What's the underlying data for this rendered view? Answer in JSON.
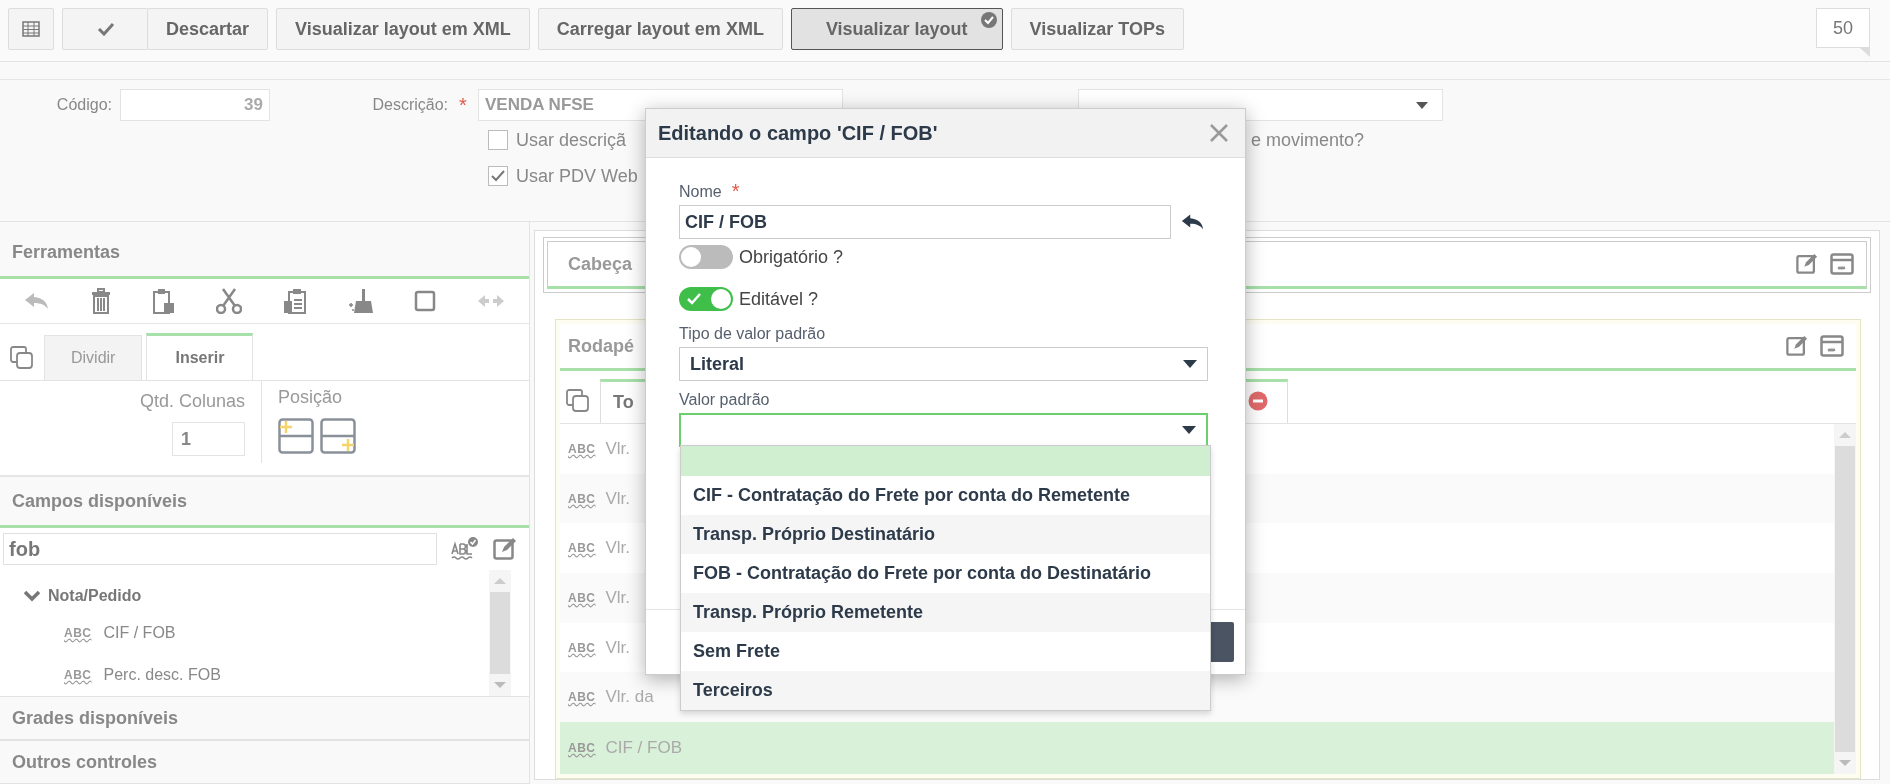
{
  "toolbar": {
    "buttons": [
      {
        "label": "Descartar",
        "selected": false
      },
      {
        "label": "Visualizar layout em XML",
        "selected": false
      },
      {
        "label": "Carregar layout em XML",
        "selected": false
      },
      {
        "label": "Visualizar layout",
        "selected": true
      },
      {
        "label": "Visualizar TOPs",
        "selected": false
      }
    ],
    "counter": "50"
  },
  "form": {
    "code_label": "Código:",
    "code_value": "39",
    "desc_label": "Descrição:",
    "desc_required_mark": "*",
    "desc_value": "VENDA NFSE",
    "checkboxes": [
      {
        "label": "Usar descriçã",
        "checked": false
      },
      {
        "label": "Usar PDV Web",
        "checked": true
      }
    ],
    "right_note": "e movimento?"
  },
  "left_panel": {
    "tools_title": "Ferramentas",
    "tabs": [
      {
        "label": "Dividir",
        "selected": false
      },
      {
        "label": "Inserir",
        "selected": true
      }
    ],
    "columns_label": "Qtd. Colunas",
    "columns_value": "1",
    "position_label": "Posição",
    "fields_title": "Campos disponíveis",
    "search_value": "fob",
    "tree": [
      {
        "label": "Nota/Pedido",
        "expanded": true,
        "children": [
          {
            "badge": "ABC",
            "label": "CIF / FOB"
          },
          {
            "badge": "ABC",
            "label": "Perc. desc. FOB"
          }
        ]
      }
    ],
    "sections": [
      "Grades disponíveis",
      "Outros controles"
    ]
  },
  "layout_panel": {
    "header_title": "Cabeça",
    "footer_title": "Rodapé",
    "tab_label": "To",
    "rows": [
      {
        "badge": "ABC",
        "label": "Vlr.",
        "selected": false
      },
      {
        "badge": "ABC",
        "label": "Vlr.",
        "selected": false
      },
      {
        "badge": "ABC",
        "label": "Vlr.",
        "selected": false
      },
      {
        "badge": "ABC",
        "label": "Vlr.",
        "selected": false
      },
      {
        "badge": "ABC",
        "label": "Vlr.",
        "selected": false
      },
      {
        "badge": "ABC",
        "label": "Vlr. da",
        "selected": false
      },
      {
        "badge": "ABC",
        "label": "CIF / FOB",
        "selected": true
      }
    ]
  },
  "dialog": {
    "title": "Editando o campo 'CIF / FOB'",
    "name_label": "Nome",
    "name_required_mark": "*",
    "name_value": "CIF / FOB",
    "toggles": [
      {
        "label": "Obrigatório ?",
        "on": false
      },
      {
        "label": "Editável ?",
        "on": true
      }
    ],
    "type_label": "Tipo de valor padrão",
    "type_value": "Literal",
    "default_label": "Valor padrão",
    "blank_option_selected": true,
    "options": [
      {
        "label": "CIF - Contratação do Frete por conta do Remetente"
      },
      {
        "label": "Transp. Próprio Destinatário"
      },
      {
        "label": "FOB - Contratação do Frete por conta do Destinatário"
      },
      {
        "label": "Transp. Próprio Remetente"
      },
      {
        "label": "Sem Frete"
      },
      {
        "label": "Terceiros"
      }
    ]
  }
}
